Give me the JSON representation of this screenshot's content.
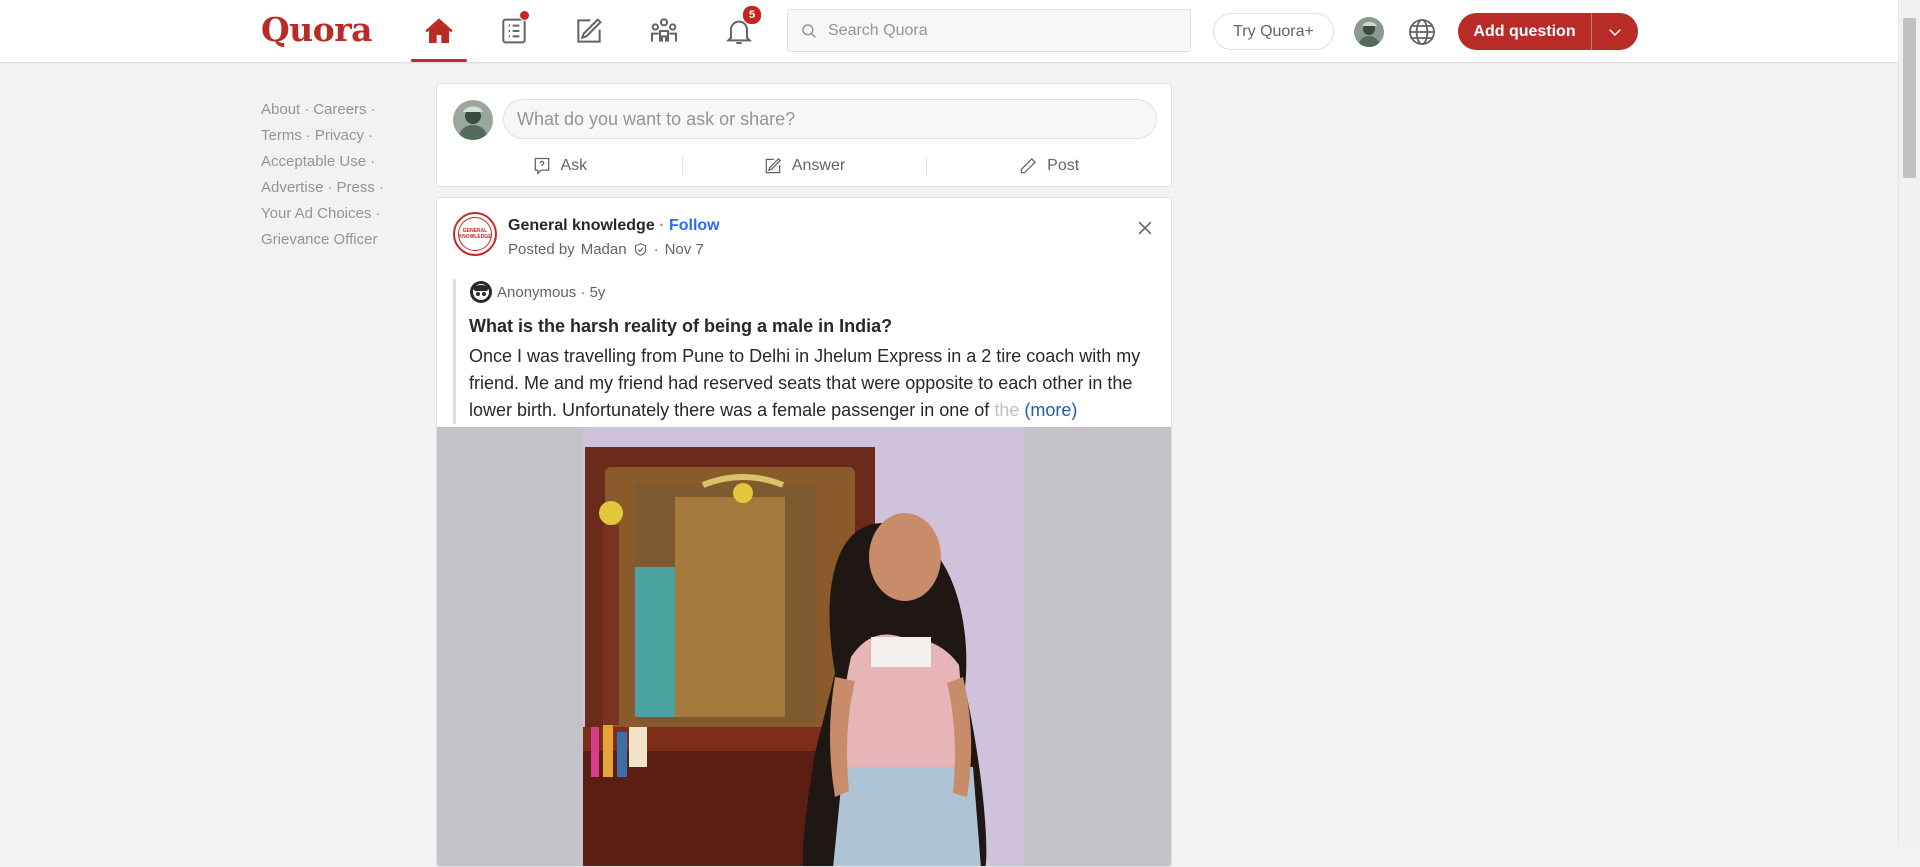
{
  "brand": {
    "logo_text": "Quora",
    "accent": "#b92b27",
    "link_color": "#2e69ff"
  },
  "nav": {
    "home_icon": "home-icon",
    "following_icon": "following-icon",
    "answer_icon": "answer-icon",
    "spaces_icon": "spaces-icon",
    "notifications_icon": "bell-icon",
    "notifications_count": "5"
  },
  "search": {
    "placeholder": "Search Quora"
  },
  "header": {
    "try_label": "Try Quora+",
    "add_question_label": "Add question"
  },
  "sidebar_links": [
    "About",
    "Careers",
    "Terms",
    "Privacy",
    "Acceptable Use",
    "Advertise",
    "Press",
    "Your Ad Choices",
    "Grievance Officer"
  ],
  "ask_box": {
    "placeholder": "What do you want to ask or share?",
    "ask_label": "Ask",
    "answer_label": "Answer",
    "post_label": "Post"
  },
  "post": {
    "space_name": "General knowledge",
    "space_logo_text": "GENERAL KNOWLEDGE",
    "follow_label": "Follow",
    "posted_by_prefix": "Posted by",
    "author": "Madan",
    "date": "Nov 7",
    "quoted": {
      "asker": "Anonymous",
      "age": "5y",
      "question": "What is the harsh reality of being a male in India?",
      "body": "Once I was travelling from Pune to Delhi in Jhelum Express in a 2 tire coach with my friend. Me and my friend had reserved seats that were opposite to each other in the lower birth. Unfortunately there was a female passenger in one of",
      "body_fade": "the",
      "more_label": "(more)"
    }
  }
}
